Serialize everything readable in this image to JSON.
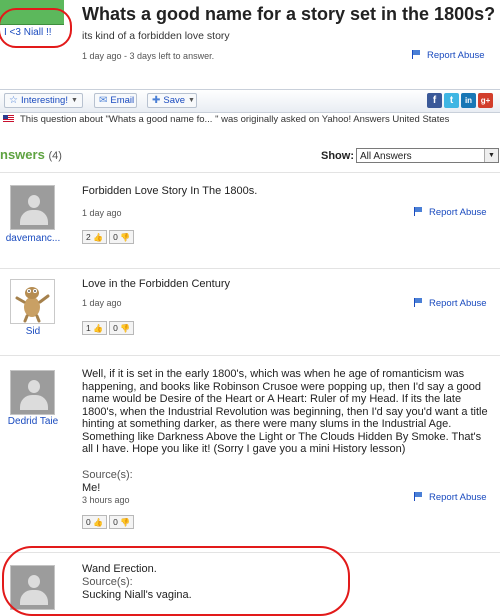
{
  "question": {
    "asker": "I <3 Niall !!",
    "title": "Whats a good name for a story set in the 1800s?",
    "subtitle": "its kind of a forbidden love story",
    "meta": "1 day ago - 3 days left to answer.",
    "report_label": "Report Abuse"
  },
  "toolbar": {
    "interesting_label": "Interesting!",
    "email_label": "Email",
    "save_label": "Save",
    "share": [
      "f",
      "t",
      "in",
      "g+"
    ]
  },
  "origin_notice": "This question about \"Whats a good name fo... \" was originally asked on Yahoo! Answers United States",
  "answers_header": {
    "label": "nswers",
    "count": "(4)",
    "show_label": "Show:",
    "show_value": "All Answers"
  },
  "answers": [
    {
      "user": "davemanc...",
      "text": "Forbidden Love Story In The 1800s.",
      "time": "1 day ago",
      "up": "2",
      "down": "0",
      "report": "Report Abuse"
    },
    {
      "user": "Sid",
      "text": "Love in the Forbidden Century",
      "time": "1 day ago",
      "up": "1",
      "down": "0",
      "report": "Report Abuse"
    },
    {
      "user": "Dedrid Taie",
      "text": "Well, if it is set in the early 1800's, which was when he age of romanticism was happening, and books like Robinson Crusoe were popping up, then I'd say a good name would be Desire of the Heart or A Heart: Ruler of my Head. If its the late 1800's, when the Industrial Revolution was beginning, then I'd say you'd want a title hinting at something darker, as there were many slums in the Industrial Age. Something like Darkness Above the Light or The Clouds Hidden By Smoke. That's all I have. Hope you like it! (Sorry I gave you a mini History lesson)",
      "source_label": "Source(s):",
      "source": "Me!",
      "time": "3 hours ago",
      "up": "0",
      "down": "0",
      "report": "Report Abuse"
    },
    {
      "text": "Wand Erection.",
      "source_label": "Source(s):",
      "source": "Sucking Niall's vagina."
    }
  ],
  "colors": {
    "link": "#1a4bbf",
    "answers_green": "#5fa341",
    "annotation_red": "#e21a1a"
  }
}
